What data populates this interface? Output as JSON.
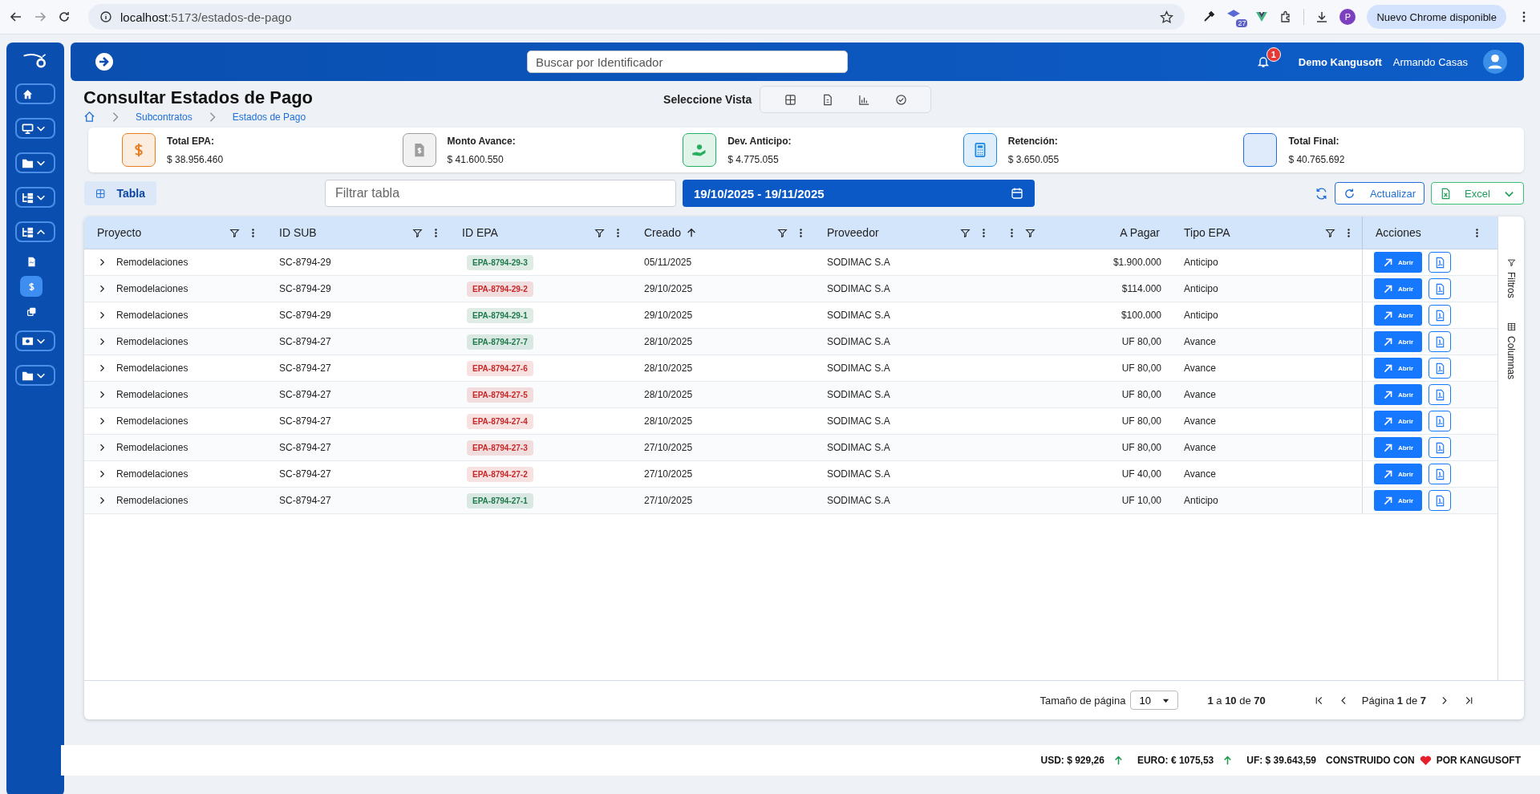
{
  "browser": {
    "url_host": "localhost",
    "url_path": ":5173/estados-de-pago",
    "extension_badge": "27",
    "profile_initial": "P",
    "update_button": "Nuevo Chrome disponible"
  },
  "header": {
    "search_placeholder": "Buscar por Identificador",
    "notification_count": "1",
    "company": "Demo Kangusoft",
    "user": "Armando Casas"
  },
  "sidebar": {
    "items": [
      {
        "kind": "home"
      },
      {
        "kind": "monitor",
        "expanded": false
      },
      {
        "kind": "folder",
        "expanded": false
      },
      {
        "kind": "tree",
        "expanded": false
      },
      {
        "kind": "tree",
        "expanded": true,
        "children": [
          {
            "kind": "doc",
            "selected": false
          },
          {
            "kind": "dollar",
            "selected": true
          },
          {
            "kind": "copy",
            "selected": false
          }
        ]
      },
      {
        "kind": "money",
        "expanded": false
      },
      {
        "kind": "folder",
        "expanded": false
      }
    ]
  },
  "page": {
    "title": "Consultar Estados de Pago",
    "breadcrumb": [
      "Subcontratos",
      "Estados de Pago"
    ],
    "view_label": "Seleccione Vista",
    "views": [
      {
        "kind": "grid"
      },
      {
        "kind": "file"
      },
      {
        "kind": "chart"
      },
      {
        "kind": "check"
      }
    ]
  },
  "summary": [
    {
      "kind": "dollar",
      "color": "#e67e22",
      "label": "Total EPA:",
      "value": "$ 38.956.460"
    },
    {
      "kind": "doc",
      "color": "#9e9e9e",
      "label": "Monto Avance:",
      "value": "$ 41.600.550"
    },
    {
      "kind": "hand",
      "color": "#27ae60",
      "label": "Dev. Anticipo:",
      "value": "$ 4.775.055"
    },
    {
      "kind": "calc",
      "color": "#1e88e5",
      "label": "Retención:",
      "value": "$ 3.650.055"
    },
    {
      "kind": "blank",
      "color": "#1e6fd9",
      "label": "Total Final:",
      "value": "$ 40.765.692"
    }
  ],
  "toolbar": {
    "tab": {
      "label": "Tabla",
      "selected": true
    },
    "filter_placeholder": "Filtrar tabla",
    "date_range": "19/10/2025 - 19/11/2025",
    "refresh_label": "Actualizar",
    "excel_label": "Excel"
  },
  "table": {
    "columns": [
      {
        "label": "Proyecto"
      },
      {
        "label": "ID SUB"
      },
      {
        "label": "ID EPA"
      },
      {
        "label": "Creado",
        "sorted": true
      },
      {
        "label": "Proveedor"
      },
      {
        "label": "A Pagar",
        "kind": "amount"
      },
      {
        "label": "Tipo EPA"
      },
      {
        "label": "Acciones",
        "kind": "actions"
      }
    ],
    "rows": [
      {
        "expanded": false,
        "cells": [
          "Remodelaciones",
          "SC-8794-29",
          {
            "text": "EPA-8794-29-3",
            "color": "#1e7a4c"
          },
          "05/11/2025",
          "SODIMAC S.A",
          "$1.900.000",
          "Anticipo"
        ],
        "action": "Abrir"
      },
      {
        "expanded": false,
        "cells": [
          "Remodelaciones",
          "SC-8794-29",
          {
            "text": "EPA-8794-29-2",
            "color": "#c62828"
          },
          "29/10/2025",
          "SODIMAC S.A",
          "$114.000",
          "Anticipo"
        ],
        "action": "Abrir"
      },
      {
        "expanded": false,
        "cells": [
          "Remodelaciones",
          "SC-8794-29",
          {
            "text": "EPA-8794-29-1",
            "color": "#1e7a4c"
          },
          "29/10/2025",
          "SODIMAC S.A",
          "$100.000",
          "Anticipo"
        ],
        "action": "Abrir"
      },
      {
        "expanded": false,
        "cells": [
          "Remodelaciones",
          "SC-8794-27",
          {
            "text": "EPA-8794-27-7",
            "color": "#1e7a4c"
          },
          "28/10/2025",
          "SODIMAC S.A",
          "UF 80,00",
          "Avance"
        ],
        "action": "Abrir"
      },
      {
        "expanded": false,
        "cells": [
          "Remodelaciones",
          "SC-8794-27",
          {
            "text": "EPA-8794-27-6",
            "color": "#c62828"
          },
          "28/10/2025",
          "SODIMAC S.A",
          "UF 80,00",
          "Avance"
        ],
        "action": "Abrir"
      },
      {
        "expanded": false,
        "cells": [
          "Remodelaciones",
          "SC-8794-27",
          {
            "text": "EPA-8794-27-5",
            "color": "#c62828"
          },
          "28/10/2025",
          "SODIMAC S.A",
          "UF 80,00",
          "Avance"
        ],
        "action": "Abrir"
      },
      {
        "expanded": false,
        "cells": [
          "Remodelaciones",
          "SC-8794-27",
          {
            "text": "EPA-8794-27-4",
            "color": "#c62828"
          },
          "28/10/2025",
          "SODIMAC S.A",
          "UF 80,00",
          "Avance"
        ],
        "action": "Abrir"
      },
      {
        "expanded": false,
        "cells": [
          "Remodelaciones",
          "SC-8794-27",
          {
            "text": "EPA-8794-27-3",
            "color": "#c62828"
          },
          "27/10/2025",
          "SODIMAC S.A",
          "UF 80,00",
          "Avance"
        ],
        "action": "Abrir"
      },
      {
        "expanded": false,
        "cells": [
          "Remodelaciones",
          "SC-8794-27",
          {
            "text": "EPA-8794-27-2",
            "color": "#c62828"
          },
          "27/10/2025",
          "SODIMAC S.A",
          "UF 40,00",
          "Avance"
        ],
        "action": "Abrir"
      },
      {
        "expanded": false,
        "cells": [
          "Remodelaciones",
          "SC-8794-27",
          {
            "text": "EPA-8794-27-1",
            "color": "#1e7a4c"
          },
          "27/10/2025",
          "SODIMAC S.A",
          "UF 10,00",
          "Anticipo"
        ],
        "action": "Abrir"
      }
    ],
    "side_panel": [
      "Filtros",
      "Columnas"
    ]
  },
  "pagination": {
    "page_size_label": "Tamaño de página",
    "page_size": "10",
    "range": "**1** a **10** de **70**",
    "page": "Página **1** de **7**"
  },
  "footer": {
    "rates": [
      {
        "text": "USD: $ 929,26",
        "kind": "rising"
      },
      {
        "text": "EURO: € 1075,53",
        "kind": "rising"
      },
      {
        "text": "UF: $ 39.643,59",
        "kind": "plain"
      }
    ],
    "credit_before": "CONSTRUIDO CON",
    "credit_after": "POR KANGUSOFT"
  }
}
